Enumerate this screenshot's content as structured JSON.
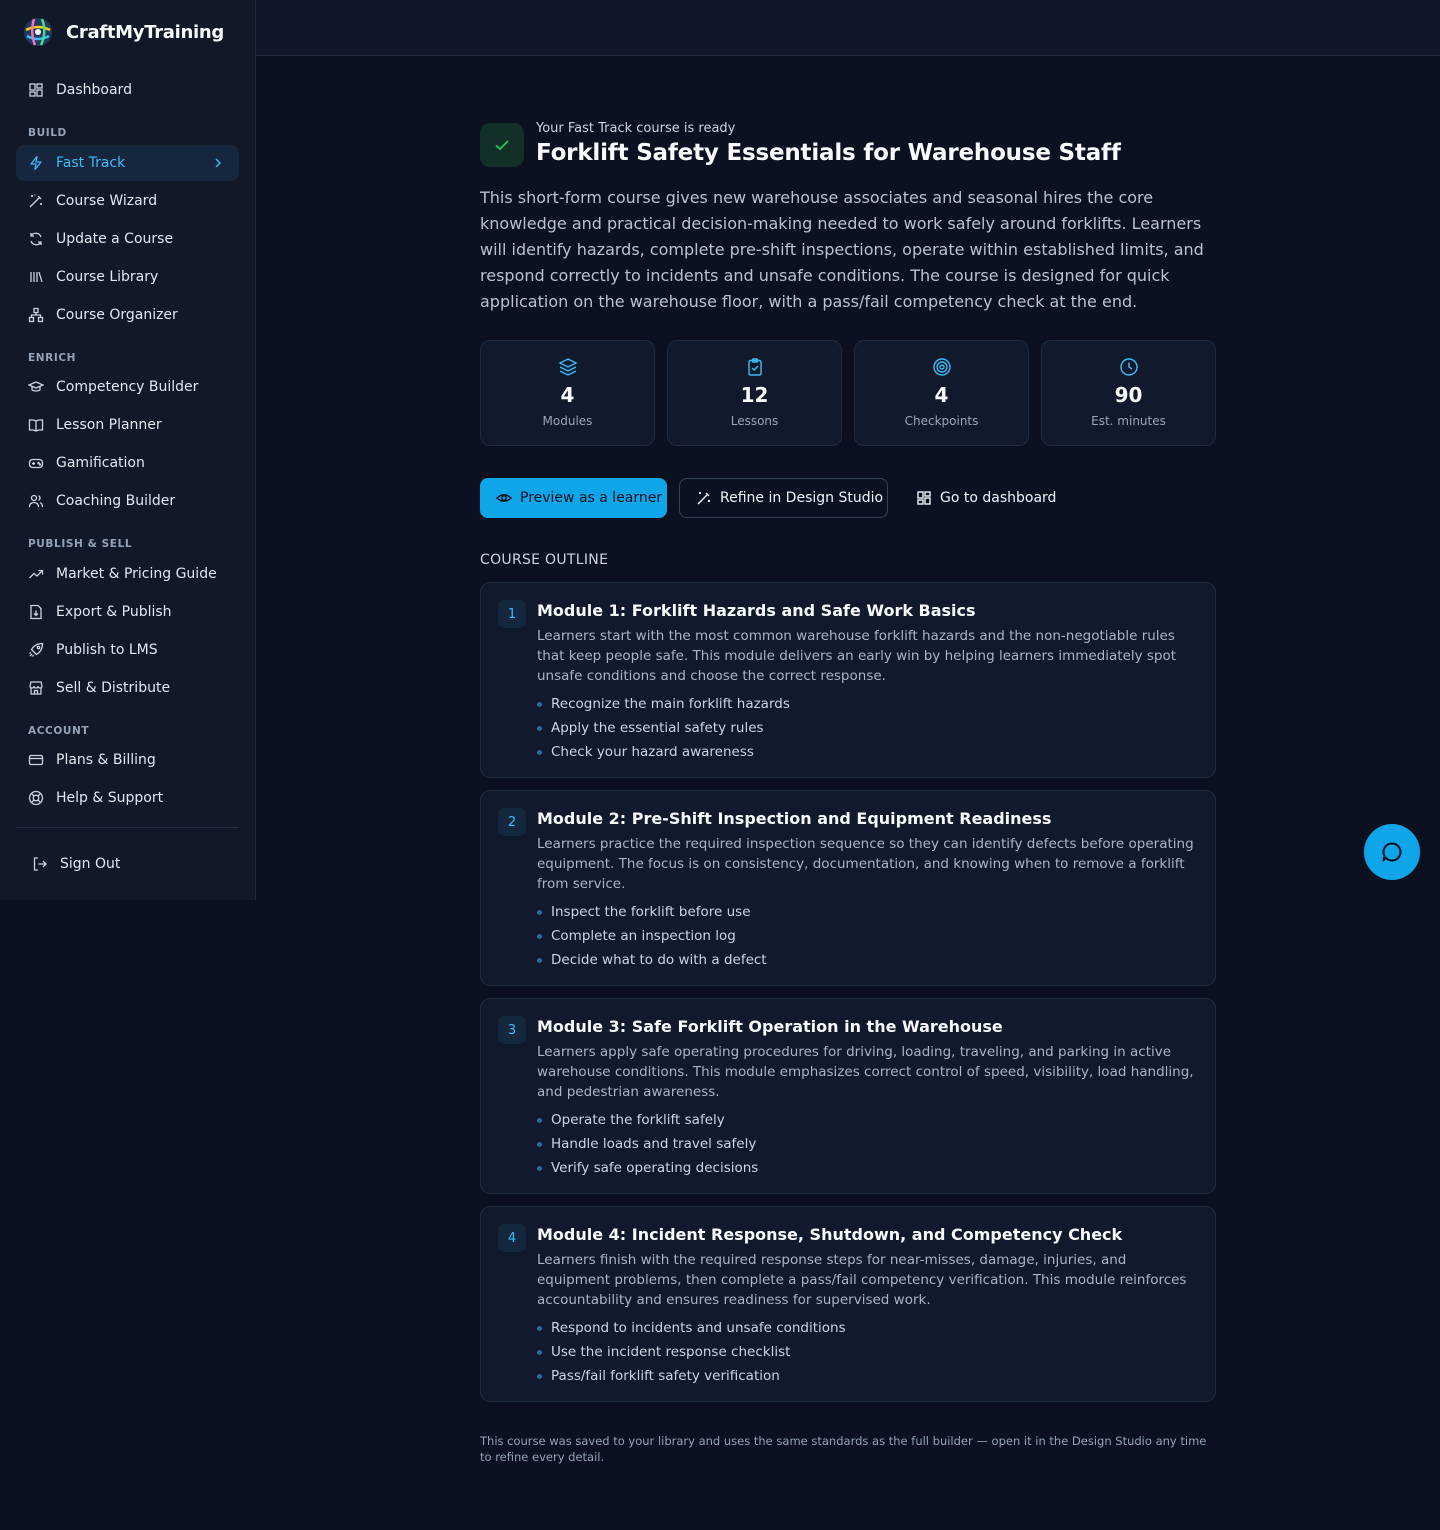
{
  "brand": {
    "name": "CraftMyTraining"
  },
  "sidebar": {
    "dashboard": "Dashboard",
    "sections": {
      "build": "BUILD",
      "enrich": "ENRICH",
      "publish": "PUBLISH & SELL",
      "account": "ACCOUNT"
    },
    "build_items": [
      "Fast Track",
      "Course Wizard",
      "Update a Course",
      "Course Library",
      "Course Organizer"
    ],
    "enrich_items": [
      "Competency Builder",
      "Lesson Planner",
      "Gamification",
      "Coaching Builder"
    ],
    "publish_items": [
      "Market & Pricing Guide",
      "Export & Publish",
      "Publish to LMS",
      "Sell & Distribute"
    ],
    "account_items": [
      "Plans & Billing",
      "Help & Support"
    ],
    "sign_out": "Sign Out",
    "active_item": "Fast Track"
  },
  "header": {
    "subtitle": "Your Fast Track course is ready",
    "title": "Forklift Safety Essentials for Warehouse Staff",
    "summary": "This short-form course gives new warehouse associates and seasonal hires the core knowledge and practical decision-making needed to work safely around forklifts. Learners will identify hazards, complete pre-shift inspections, operate within established limits, and respond correctly to incidents and unsafe conditions. The course is designed for quick application on the warehouse floor, with a pass/fail competency check at the end."
  },
  "stats": [
    {
      "value": "4",
      "label": "Modules",
      "icon": "layers-icon"
    },
    {
      "value": "12",
      "label": "Lessons",
      "icon": "clipboard-check-icon"
    },
    {
      "value": "4",
      "label": "Checkpoints",
      "icon": "target-icon"
    },
    {
      "value": "90",
      "label": "Est. minutes",
      "icon": "clock-icon"
    }
  ],
  "actions": {
    "preview": "Preview as a learner",
    "refine": "Refine in Design Studio",
    "dashboard": "Go to dashboard"
  },
  "outline": {
    "label": "COURSE OUTLINE",
    "modules": [
      {
        "num": "1",
        "title": "Module 1: Forklift Hazards and Safe Work Basics",
        "desc": "Learners start with the most common warehouse forklift hazards and the non-negotiable rules that keep people safe. This module delivers an early win by helping learners immediately spot unsafe conditions and choose the correct response.",
        "lessons": [
          "Recognize the main forklift hazards",
          "Apply the essential safety rules",
          "Check your hazard awareness"
        ]
      },
      {
        "num": "2",
        "title": "Module 2: Pre-Shift Inspection and Equipment Readiness",
        "desc": "Learners practice the required inspection sequence so they can identify defects before operating equipment. The focus is on consistency, documentation, and knowing when to remove a forklift from service.",
        "lessons": [
          "Inspect the forklift before use",
          "Complete an inspection log",
          "Decide what to do with a defect"
        ]
      },
      {
        "num": "3",
        "title": "Module 3: Safe Forklift Operation in the Warehouse",
        "desc": "Learners apply safe operating procedures for driving, loading, traveling, and parking in active warehouse conditions. This module emphasizes correct control of speed, visibility, load handling, and pedestrian awareness.",
        "lessons": [
          "Operate the forklift safely",
          "Handle loads and travel safely",
          "Verify safe operating decisions"
        ]
      },
      {
        "num": "4",
        "title": "Module 4: Incident Response, Shutdown, and Competency Check",
        "desc": "Learners finish with the required response steps for near-misses, damage, injuries, and equipment problems, then complete a pass/fail competency verification. This module reinforces accountability and ensures readiness for supervised work.",
        "lessons": [
          "Respond to incidents and unsafe conditions",
          "Use the incident response checklist",
          "Pass/fail forklift safety verification"
        ]
      }
    ]
  },
  "footnote": "This course was saved to your library and uses the same standards as the full builder — open it in the Design Studio any time to refine every detail.",
  "colors": {
    "accent": "#0ea5e9",
    "active_text": "#38bdf8",
    "success": "#22c55e",
    "background": "#0b1120"
  }
}
